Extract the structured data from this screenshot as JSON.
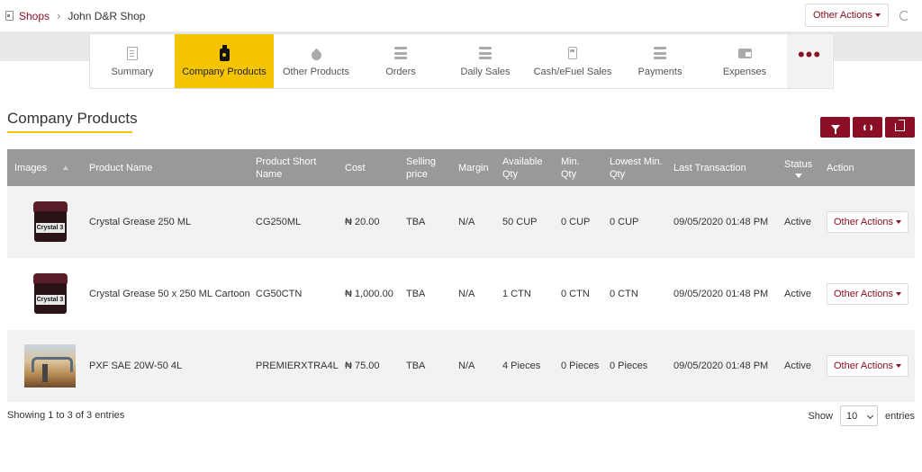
{
  "breadcrumb": {
    "root": "Shops",
    "separator": "›",
    "current": "John D&R Shop"
  },
  "header": {
    "other_actions": "Other Actions"
  },
  "tabs": [
    {
      "label": "Summary",
      "icon": "document-icon"
    },
    {
      "label": "Company Products",
      "icon": "bottle-icon",
      "active": true
    },
    {
      "label": "Other Products",
      "icon": "drop-icon"
    },
    {
      "label": "Orders",
      "icon": "server-icon"
    },
    {
      "label": "Daily Sales",
      "icon": "server-icon"
    },
    {
      "label": "Cash/eFuel Sales",
      "icon": "fuel-pump-icon"
    },
    {
      "label": "Payments",
      "icon": "server-icon"
    },
    {
      "label": "Expenses",
      "icon": "wallet-icon"
    },
    {
      "label": "•••",
      "icon": "more-icon"
    }
  ],
  "page": {
    "title": "Company Products"
  },
  "colors": {
    "accent": "#8a0f24",
    "highlight": "#f5c400",
    "header_bg": "#999999"
  },
  "table": {
    "headers": {
      "images": "Images",
      "product_name": "Product Name",
      "short_name_1": "Product Short",
      "short_name_2": "Name",
      "cost": "Cost",
      "selling_1": "Selling",
      "selling_2": "price",
      "margin": "Margin",
      "avail_1": "Available",
      "avail_2": "Qty",
      "min_1": "Min.",
      "min_2": "Qty",
      "lowest_1": "Lowest Min.",
      "lowest_2": "Qty",
      "last_transaction": "Last Transaction",
      "status": "Status",
      "action": "Action"
    },
    "rows": [
      {
        "image": "grease-tub",
        "image_text": "Crystal 3",
        "name": "Crystal Grease 250 ML",
        "short": "CG250ML",
        "cost": "₦ 20.00",
        "selling": "TBA",
        "margin": "N/A",
        "available": "50 CUP",
        "min": "0 CUP",
        "lowest": "0 CUP",
        "last": "09/05/2020 01:48 PM",
        "status": "Active",
        "action": "Other Actions"
      },
      {
        "image": "grease-tub",
        "image_text": "Crystal 3",
        "name": "Crystal Grease 50 x 250 ML Cartoon",
        "short": "CG50CTN",
        "cost": "₦ 1,000.00",
        "selling": "TBA",
        "margin": "N/A",
        "available": "1 CTN",
        "min": "0 CTN",
        "lowest": "0 CTN",
        "last": "09/05/2020 01:48 PM",
        "status": "Active",
        "action": "Other Actions"
      },
      {
        "image": "site-photo",
        "name": "PXF SAE 20W-50 4L",
        "short": "PREMIERXTRA4L",
        "cost": "₦ 75.00",
        "selling": "TBA",
        "margin": "N/A",
        "available": "4 Pieces",
        "min": "0 Pieces",
        "lowest": "0 Pieces",
        "last": "09/05/2020 01:48 PM",
        "status": "Active",
        "action": "Other Actions"
      }
    ]
  },
  "footer": {
    "info": "Showing 1 to 3 of 3 entries",
    "show_label": "Show",
    "page_size": "10",
    "entries_label": "entries"
  }
}
